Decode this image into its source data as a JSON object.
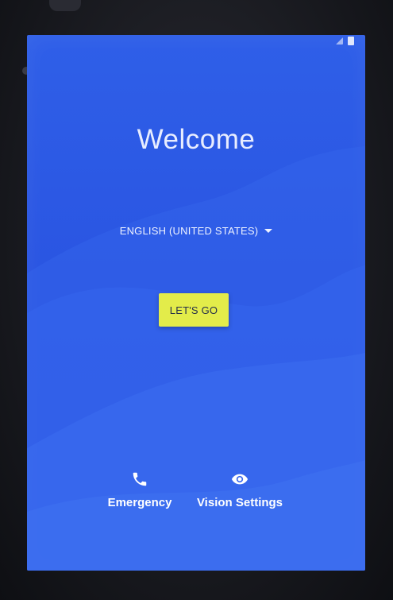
{
  "screen": {
    "title": "Welcome",
    "language_selector": {
      "selected": "ENGLISH (UNITED STATES)"
    },
    "primary_button": {
      "label": "LET'S GO"
    },
    "bottom_actions": [
      {
        "label": "Emergency",
        "icon": "phone-icon"
      },
      {
        "label": "Vision Settings",
        "icon": "eye-icon"
      }
    ]
  },
  "colors": {
    "background": "#2a55e2",
    "button": "#e3ec4a",
    "text": "#ffffff"
  }
}
